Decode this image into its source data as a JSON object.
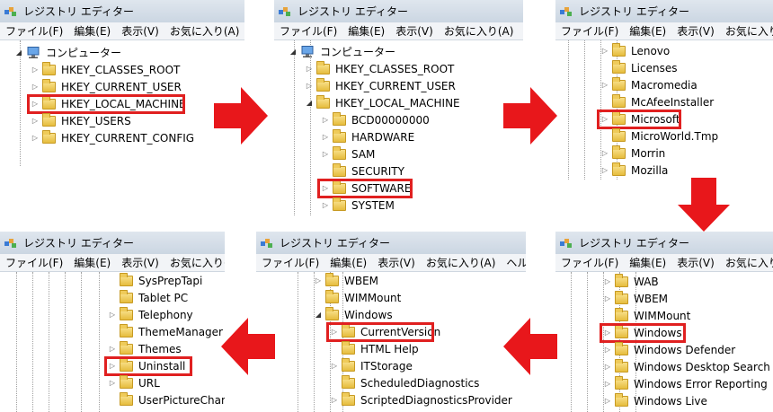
{
  "window": {
    "title": "レジストリ エディター"
  },
  "menu": [
    "ファイル(F)",
    "編集(E)",
    "表示(V)",
    "お気に入り(A)",
    "ヘルプ(H)"
  ],
  "colors": {
    "highlight": "#e02020",
    "arrow": "#e8171b",
    "folder": "#e6bc3d",
    "titlebar": "#d4dde8"
  },
  "panels": [
    {
      "id": "p1",
      "rows": [
        {
          "label": "コンピューター",
          "icon": "computer-icon",
          "level": 0,
          "expander": "open"
        },
        {
          "label": "HKEY_CLASSES_ROOT",
          "icon": "folder-icon",
          "level": 1,
          "expander": "closed"
        },
        {
          "label": "HKEY_CURRENT_USER",
          "icon": "folder-icon",
          "level": 1,
          "expander": "closed"
        },
        {
          "label": "HKEY_LOCAL_MACHINE",
          "icon": "folder-icon",
          "level": 1,
          "expander": "closed",
          "highlight": true
        },
        {
          "label": "HKEY_USERS",
          "icon": "folder-icon",
          "level": 1,
          "expander": "closed"
        },
        {
          "label": "HKEY_CURRENT_CONFIG",
          "icon": "folder-icon",
          "level": 1,
          "expander": "closed"
        }
      ]
    },
    {
      "id": "p2",
      "rows": [
        {
          "label": "コンピューター",
          "icon": "computer-icon",
          "level": 0,
          "expander": "open"
        },
        {
          "label": "HKEY_CLASSES_ROOT",
          "icon": "folder-icon",
          "level": 1,
          "expander": "closed"
        },
        {
          "label": "HKEY_CURRENT_USER",
          "icon": "folder-icon",
          "level": 1,
          "expander": "closed"
        },
        {
          "label": "HKEY_LOCAL_MACHINE",
          "icon": "folder-icon",
          "level": 1,
          "expander": "open"
        },
        {
          "label": "BCD00000000",
          "icon": "folder-icon",
          "level": 2,
          "expander": "closed"
        },
        {
          "label": "HARDWARE",
          "icon": "folder-icon",
          "level": 2,
          "expander": "closed"
        },
        {
          "label": "SAM",
          "icon": "folder-icon",
          "level": 2,
          "expander": "closed"
        },
        {
          "label": "SECURITY",
          "icon": "folder-icon",
          "level": 2,
          "expander": "none"
        },
        {
          "label": "SOFTWARE",
          "icon": "folder-icon",
          "level": 2,
          "expander": "closed",
          "highlight": true
        },
        {
          "label": "SYSTEM",
          "icon": "folder-icon",
          "level": 2,
          "expander": "closed"
        }
      ]
    },
    {
      "id": "p3",
      "rows": [
        {
          "label": "Lenovo",
          "icon": "folder-icon",
          "level": 3,
          "expander": "closed"
        },
        {
          "label": "Licenses",
          "icon": "folder-icon",
          "level": 3,
          "expander": "none"
        },
        {
          "label": "Macromedia",
          "icon": "folder-icon",
          "level": 3,
          "expander": "closed"
        },
        {
          "label": "McAfeeInstaller",
          "icon": "folder-icon",
          "level": 3,
          "expander": "none"
        },
        {
          "label": "Microsoft",
          "icon": "folder-icon",
          "level": 3,
          "expander": "closed",
          "highlight": true
        },
        {
          "label": "MicroWorld.Tmp",
          "icon": "folder-icon",
          "level": 3,
          "expander": "none"
        },
        {
          "label": "Morrin",
          "icon": "folder-icon",
          "level": 3,
          "expander": "closed"
        },
        {
          "label": "Mozilla",
          "icon": "folder-icon",
          "level": 3,
          "expander": "closed"
        }
      ]
    },
    {
      "id": "p4",
      "rows": [
        {
          "label": "WAB",
          "icon": "folder-icon",
          "level": 4,
          "expander": "closed"
        },
        {
          "label": "WBEM",
          "icon": "folder-icon",
          "level": 4,
          "expander": "closed"
        },
        {
          "label": "WIMMount",
          "icon": "folder-icon",
          "level": 4,
          "expander": "none"
        },
        {
          "label": "Windows",
          "icon": "folder-icon",
          "level": 4,
          "expander": "closed",
          "highlight": true
        },
        {
          "label": "Windows Defender",
          "icon": "folder-icon",
          "level": 4,
          "expander": "closed"
        },
        {
          "label": "Windows Desktop Search",
          "icon": "folder-icon",
          "level": 4,
          "expander": "closed"
        },
        {
          "label": "Windows Error Reporting",
          "icon": "folder-icon",
          "level": 4,
          "expander": "closed"
        },
        {
          "label": "Windows Live",
          "icon": "folder-icon",
          "level": 4,
          "expander": "closed"
        }
      ]
    },
    {
      "id": "p5",
      "rows": [
        {
          "label": "WBEM",
          "icon": "folder-icon",
          "level": 4,
          "expander": "closed"
        },
        {
          "label": "WIMMount",
          "icon": "folder-icon",
          "level": 4,
          "expander": "none"
        },
        {
          "label": "Windows",
          "icon": "folder-icon",
          "level": 4,
          "expander": "open"
        },
        {
          "label": "CurrentVersion",
          "icon": "folder-icon",
          "level": 5,
          "expander": "closed",
          "highlight": true
        },
        {
          "label": "HTML Help",
          "icon": "folder-icon",
          "level": 5,
          "expander": "none"
        },
        {
          "label": "ITStorage",
          "icon": "folder-icon",
          "level": 5,
          "expander": "closed"
        },
        {
          "label": "ScheduledDiagnostics",
          "icon": "folder-icon",
          "level": 5,
          "expander": "none"
        },
        {
          "label": "ScriptedDiagnosticsProvider",
          "icon": "folder-icon",
          "level": 5,
          "expander": "closed"
        }
      ]
    },
    {
      "id": "p6",
      "rows": [
        {
          "label": "SysPrepTapi",
          "icon": "folder-icon",
          "level": 6,
          "expander": "none"
        },
        {
          "label": "Tablet PC",
          "icon": "folder-icon",
          "level": 6,
          "expander": "none"
        },
        {
          "label": "Telephony",
          "icon": "folder-icon",
          "level": 6,
          "expander": "closed"
        },
        {
          "label": "ThemeManager",
          "icon": "folder-icon",
          "level": 6,
          "expander": "none"
        },
        {
          "label": "Themes",
          "icon": "folder-icon",
          "level": 6,
          "expander": "closed"
        },
        {
          "label": "Uninstall",
          "icon": "folder-icon",
          "level": 6,
          "expander": "closed",
          "highlight": true
        },
        {
          "label": "URL",
          "icon": "folder-icon",
          "level": 6,
          "expander": "closed"
        },
        {
          "label": "UserPictureChange",
          "icon": "folder-icon",
          "level": 6,
          "expander": "none"
        }
      ]
    }
  ]
}
